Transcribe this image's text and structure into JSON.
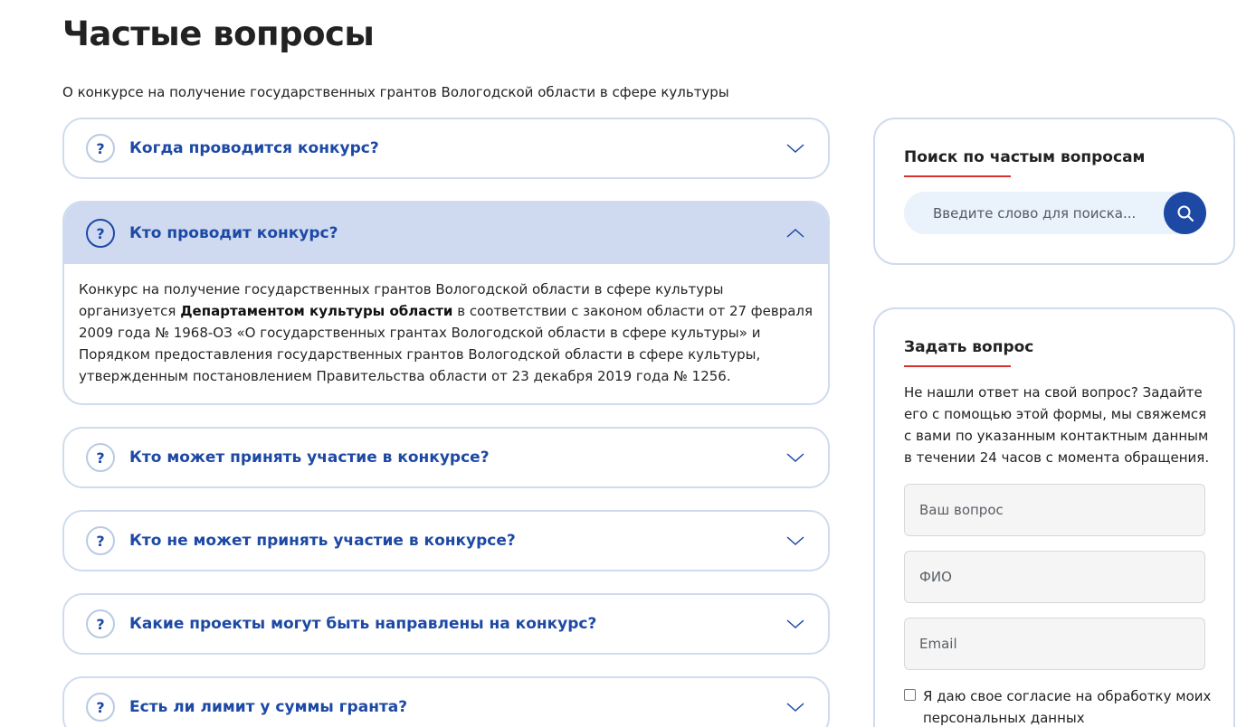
{
  "page": {
    "title": "Частые вопросы",
    "subtitle": "О конкурсе на получение государственных грантов Вологодской области в сфере культуры"
  },
  "faq": [
    {
      "question": "Когда проводится конкурс?",
      "open": false
    },
    {
      "question": "Кто проводит конкурс?",
      "open": true,
      "answer_before": "Конкурс на получение государственных грантов Вологодской области в сфере культуры организуется ",
      "answer_bold": "Департаментом культуры области",
      "answer_after": " в соответствии с законом области от 27 февраля 2009 года № 1968-ОЗ «О государственных грантах Вологодской области в сфере культуры» и Порядком предоставления государственных грантов Вологодской области в сфере культуры, утвержденным постановлением Правительства области от 23 декабря 2019 года № 1256."
    },
    {
      "question": "Кто может принять участие в конкурсе?",
      "open": false
    },
    {
      "question": "Кто не может принять участие в конкурсе?",
      "open": false
    },
    {
      "question": "Какие проекты могут быть направлены на конкурс?",
      "open": false
    },
    {
      "question": "Есть ли лимит у суммы гранта?",
      "open": false
    }
  ],
  "badge_symbol": "?",
  "search": {
    "title": "Поиск по частым вопросам",
    "placeholder": "Введите слово для поиска..."
  },
  "ask": {
    "title": "Задать вопрос",
    "description": "Не нашли ответ на свой вопрос? Задайте его с помощью этой формы, мы свяжемся с вами по указанным контактным данным в течении 24 часов с момента обращения.",
    "question_placeholder": "Ваш вопрос",
    "name_placeholder": "ФИО",
    "email_placeholder": "Email",
    "consent_label": "Я даю свое согласие на обработку моих персональных данных"
  },
  "colors": {
    "accent": "#1d49a5",
    "open_header": "#cfdaf0",
    "border": "#cfdced",
    "underline": "#d8332c"
  },
  "icons": {
    "question_badge": "question-icon",
    "chevron_closed": "chevron-down-icon",
    "chevron_open": "chevron-up-icon",
    "search": "search-icon"
  }
}
